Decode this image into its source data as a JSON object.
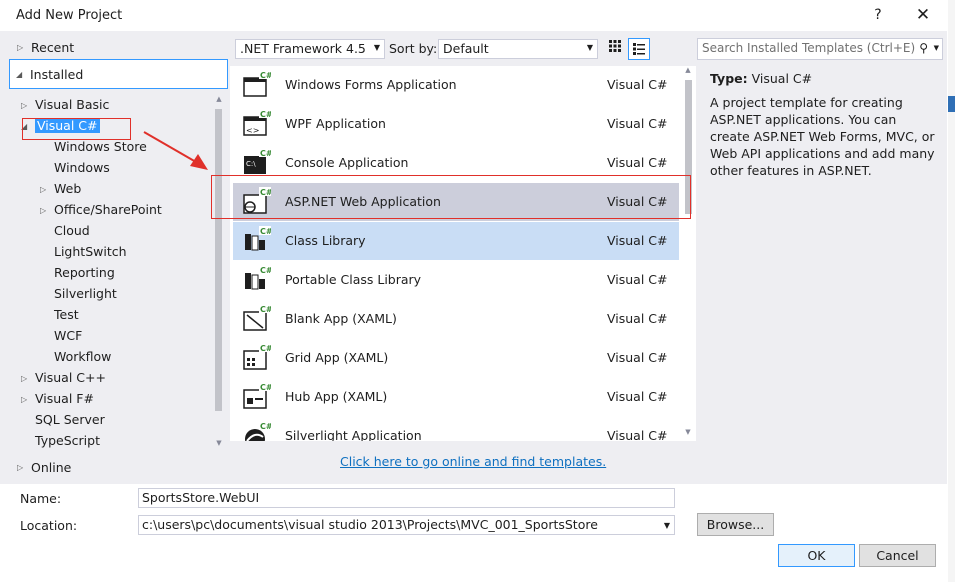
{
  "dialog": {
    "title": "Add New Project",
    "help_glyph": "?",
    "close_glyph": "✕"
  },
  "tree": {
    "recent": "Recent",
    "installed": "Installed",
    "online": "Online",
    "items": [
      {
        "label": "Visual Basic",
        "expander": "▷"
      },
      {
        "label": "Visual C#",
        "expander": "◢"
      },
      {
        "label": "Windows Store",
        "expander": ""
      },
      {
        "label": "Windows",
        "expander": ""
      },
      {
        "label": "Web",
        "expander": "▷"
      },
      {
        "label": "Office/SharePoint",
        "expander": "▷"
      },
      {
        "label": "Cloud",
        "expander": ""
      },
      {
        "label": "LightSwitch",
        "expander": ""
      },
      {
        "label": "Reporting",
        "expander": ""
      },
      {
        "label": "Silverlight",
        "expander": ""
      },
      {
        "label": "Test",
        "expander": ""
      },
      {
        "label": "WCF",
        "expander": ""
      },
      {
        "label": "Workflow",
        "expander": ""
      },
      {
        "label": "Visual C++",
        "expander": "▷"
      },
      {
        "label": "Visual F#",
        "expander": "▷"
      },
      {
        "label": "SQL Server",
        "expander": ""
      },
      {
        "label": "TypeScript",
        "expander": ""
      }
    ]
  },
  "toolbar": {
    "framework": ".NET Framework 4.5",
    "sort_label": "Sort by:",
    "sort_value": "Default",
    "search_placeholder": "Search Installed Templates (Ctrl+E)"
  },
  "templates": [
    {
      "name": "Windows Forms Application",
      "lang": "Visual C#",
      "icon": "winforms-icon"
    },
    {
      "name": "WPF Application",
      "lang": "Visual C#",
      "icon": "wpf-icon"
    },
    {
      "name": "Console Application",
      "lang": "Visual C#",
      "icon": "console-icon"
    },
    {
      "name": "ASP.NET Web Application",
      "lang": "Visual C#",
      "icon": "web-app-icon"
    },
    {
      "name": "Class Library",
      "lang": "Visual C#",
      "icon": "class-library-icon"
    },
    {
      "name": "Portable Class Library",
      "lang": "Visual C#",
      "icon": "portable-library-icon"
    },
    {
      "name": "Blank App (XAML)",
      "lang": "Visual C#",
      "icon": "blank-app-icon"
    },
    {
      "name": "Grid App (XAML)",
      "lang": "Visual C#",
      "icon": "grid-app-icon"
    },
    {
      "name": "Hub App (XAML)",
      "lang": "Visual C#",
      "icon": "hub-app-icon"
    },
    {
      "name": "Silverlight Application",
      "lang": "Visual C#",
      "icon": "silverlight-icon"
    }
  ],
  "online_link": "Click here to go online and find templates.",
  "description": {
    "type_label": "Type:",
    "type_value": "Visual C#",
    "text": "A project template for creating ASP.NET applications. You can create ASP.NET Web Forms, MVC,  or Web API applications and add many other features in ASP.NET."
  },
  "form": {
    "name_label": "Name:",
    "name_value": "SportsStore.WebUI",
    "location_label": "Location:",
    "location_value": "c:\\users\\pc\\documents\\visual studio 2013\\Projects\\MVC_001_SportsStore",
    "browse_label": "Browse...",
    "ok_label": "OK",
    "cancel_label": "Cancel"
  },
  "colors": {
    "selection": "#3399ff",
    "hover_row": "#c9ddf5",
    "selected_row": "#cccedb",
    "annotation_red": "#e0302a",
    "link": "#0e70c0"
  }
}
